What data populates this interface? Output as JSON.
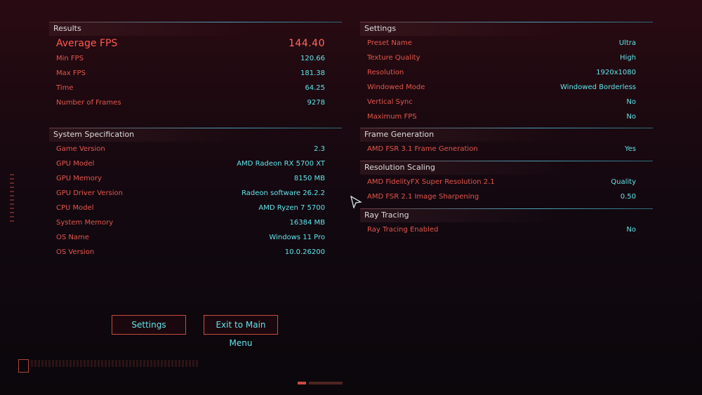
{
  "results": {
    "header": "Results",
    "rows": [
      {
        "label": "Average FPS",
        "value": "144.40"
      },
      {
        "label": "Min FPS",
        "value": "120.66"
      },
      {
        "label": "Max FPS",
        "value": "181.38"
      },
      {
        "label": "Time",
        "value": "64.25"
      },
      {
        "label": "Number of Frames",
        "value": "9278"
      }
    ]
  },
  "system": {
    "header": "System Specification",
    "rows": [
      {
        "label": "Game Version",
        "value": "2.3"
      },
      {
        "label": "GPU Model",
        "value": "AMD Radeon RX 5700 XT"
      },
      {
        "label": "GPU Memory",
        "value": "8150 MB"
      },
      {
        "label": "GPU Driver Version",
        "value": "Radeon software 26.2.2"
      },
      {
        "label": "CPU Model",
        "value": "AMD Ryzen 7 5700"
      },
      {
        "label": "System Memory",
        "value": "16384 MB"
      },
      {
        "label": "OS Name",
        "value": "Windows 11 Pro"
      },
      {
        "label": "OS Version",
        "value": "10.0.26200"
      }
    ]
  },
  "settings": {
    "header": "Settings",
    "rows": [
      {
        "label": "Preset Name",
        "value": "Ultra"
      },
      {
        "label": "Texture Quality",
        "value": "High"
      },
      {
        "label": "Resolution",
        "value": "1920x1080"
      },
      {
        "label": "Windowed Mode",
        "value": "Windowed Borderless"
      },
      {
        "label": "Vertical Sync",
        "value": "No"
      },
      {
        "label": "Maximum FPS",
        "value": "No"
      }
    ]
  },
  "frame_generation": {
    "header": "Frame Generation",
    "rows": [
      {
        "label": "AMD FSR 3.1 Frame Generation",
        "value": "Yes"
      }
    ]
  },
  "resolution_scaling": {
    "header": "Resolution Scaling",
    "rows": [
      {
        "label": "AMD FidelityFX Super Resolution 2.1",
        "value": "Quality"
      },
      {
        "label": "AMD FSR 2.1 Image Sharpening",
        "value": "0.50"
      }
    ]
  },
  "ray_tracing": {
    "header": "Ray Tracing",
    "rows": [
      {
        "label": "Ray Tracing Enabled",
        "value": "No"
      }
    ]
  },
  "buttons": {
    "settings": "Settings",
    "exit": "Exit to Main Menu"
  },
  "colors": {
    "label": "#e2574c",
    "value": "#5fe6ec",
    "accent_line": "#4aa3b8"
  }
}
